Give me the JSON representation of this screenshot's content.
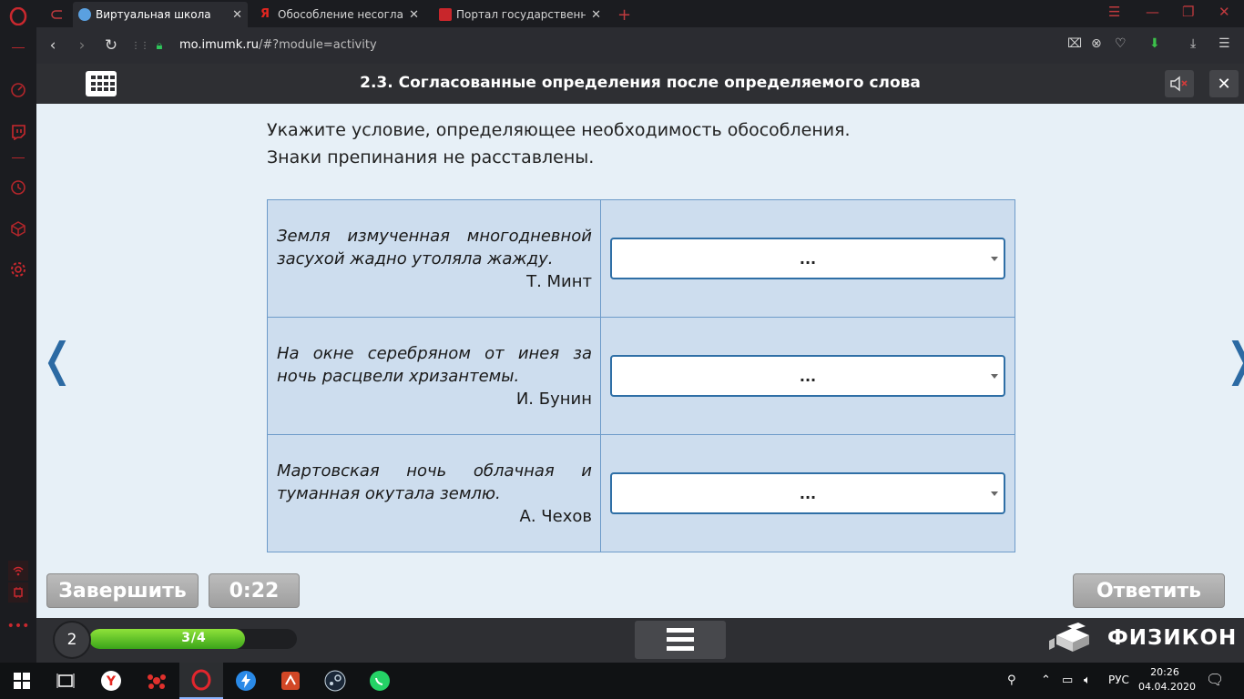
{
  "browser": {
    "tabs": [
      {
        "title": "Виртуальная школа",
        "active": true,
        "favicon_color": "#5aa0e0"
      },
      {
        "title": "Обособление несогласов",
        "active": false,
        "favicon_color": "#e52620"
      },
      {
        "title": "Портал государственных",
        "active": false,
        "favicon_color": "#c8262b"
      }
    ],
    "new_tab_label": "+",
    "url_host": "mo.imumk.ru",
    "url_path": "/#?module=activity"
  },
  "app": {
    "title": "2.3. Согласованные определения после определяемого слова",
    "instruction_line1": "Укажите условие, определяющее необходимость обособления.",
    "instruction_line2": "Знаки препинания не расставлены.",
    "prev_arrow": "❬",
    "next_arrow": "❭",
    "rows": [
      {
        "text": "Земля измученная многодневной засухой жадно утоляла жажду.",
        "author": "Т. Минт",
        "selected": "..."
      },
      {
        "text": "На окне серебряном от инея за ночь расцвели хризантемы.",
        "author": "И. Бунин",
        "selected": "..."
      },
      {
        "text": "Мартовская ночь облачная и туманная окутала землю.",
        "author": "А. Чехов",
        "selected": "..."
      }
    ],
    "finish_label": "Завершить",
    "timer": "0:22",
    "answer_label": "Ответить",
    "level": "2",
    "progress_label": "3/4",
    "progress_fraction": 0.75,
    "logo_text": "ФИЗИКОН"
  },
  "taskbar": {
    "lang": "РУС",
    "time": "20:26",
    "date": "04.04.2020"
  }
}
